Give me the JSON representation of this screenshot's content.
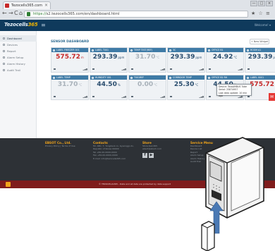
{
  "browser": {
    "tab_title": "Tezocells365.com",
    "tab_close": "×",
    "back": "←",
    "forward": "→",
    "reload": "C",
    "home": "⌂",
    "url_scheme": "https://",
    "url_rest": "s2.tezocells365.com/en/dashboard.html",
    "window_controls": [
      "—",
      "□",
      "×"
    ],
    "toolbar_glyphs": "★ ☆ ≡"
  },
  "appbar": {
    "logo_text_a": "Tezocells",
    "logo_text_b": "365",
    "right_text": "Welcome!   ▾"
  },
  "sidebar": {
    "items": [
      {
        "label": "Dashboard",
        "active": true
      },
      {
        "label": "Devices",
        "active": false
      },
      {
        "label": "Report",
        "active": false
      },
      {
        "label": "Alarm Setup",
        "active": false
      },
      {
        "label": "Alarm History",
        "active": false
      },
      {
        "label": "Audit Trail",
        "active": false
      }
    ]
  },
  "main": {
    "section_title": "SENSOR DASHBOARD",
    "right_button": "+ New Widget"
  },
  "cards": [
    {
      "title": "LABEL FREEZER 001",
      "value": "575.72",
      "unit": "m",
      "state": "alert"
    },
    {
      "title": "LABEL T001",
      "value": "293.39",
      "unit": "ppm",
      "state": "normal"
    },
    {
      "title": "TEMP TEST(REF)",
      "value": "31.70",
      "unit": "°C",
      "state": "muted"
    },
    {
      "title": "3C",
      "value": "293.39",
      "unit": "ppm",
      "state": "normal"
    },
    {
      "title": "OFFICE B1",
      "value": "24.92",
      "unit": "°C",
      "state": "normal"
    },
    {
      "title": "ROOM A1",
      "value": "293.39",
      "unit": "ppm",
      "state": "normal"
    },
    {
      "title": "LABEL TEMP",
      "value": "31.70",
      "unit": "°C",
      "state": "muted"
    },
    {
      "title": "HUMIDITY 001",
      "value": "44.50",
      "unit": "%",
      "state": "normal"
    },
    {
      "title": "T001REF",
      "value": "0.00",
      "unit": "°C",
      "state": "muted"
    },
    {
      "title": "CORRIDOR TEMP",
      "value": "25.30",
      "unit": "°C",
      "state": "normal"
    },
    {
      "title": "OFFICE B2 RH",
      "value": "44.50",
      "unit": "%",
      "state": "normal"
    },
    {
      "title": "LABEL 0001",
      "value": "575.72",
      "unit": "m",
      "state": "alert"
    }
  ],
  "tooltip": {
    "line1": "Device: TezoAMBUS Tube",
    "line2": "Serial: 25874957",
    "line3": "Last data update: 10 min ago"
  },
  "footer": {
    "company": {
      "title": "EBSOT Co., Ltd.",
      "lines": [
        "Privacy Policy  |  Terms of Use"
      ]
    },
    "contact": {
      "title": "Contacts",
      "lines": [
        "Mr. ABC, 7, Yongdeok-ro, Gyeonggi-do,",
        "Republic of Korea 00000",
        "Tel +82-00-0000-0000",
        "Fax +82-00-0000-0000",
        "E-mail: info@tezocells365.com"
      ]
    },
    "store": {
      "title": "Store",
      "lines": [
        "Store.tezo365",
        "ebsot@ebsot.com"
      ]
    },
    "social": [
      "f",
      "▶"
    ],
    "service": {
      "title": "Service Menu",
      "lines": [
        "Dashboard",
        "Device List",
        "Report",
        "Alarm Setup",
        "Alarm History",
        "Audit Trail"
      ]
    },
    "bottom_text": "© TEZOCELLS365 - Data and all data are protected by data support"
  },
  "side_tab_glyph": "✉",
  "colors": {
    "appbar": "#0f3a5c",
    "card_header": "#3f7ba6",
    "alert": "#c62828",
    "footer": "#2d3136",
    "footer_accent": "#f2a51a",
    "bottom_bar": "#7f1c1c"
  }
}
